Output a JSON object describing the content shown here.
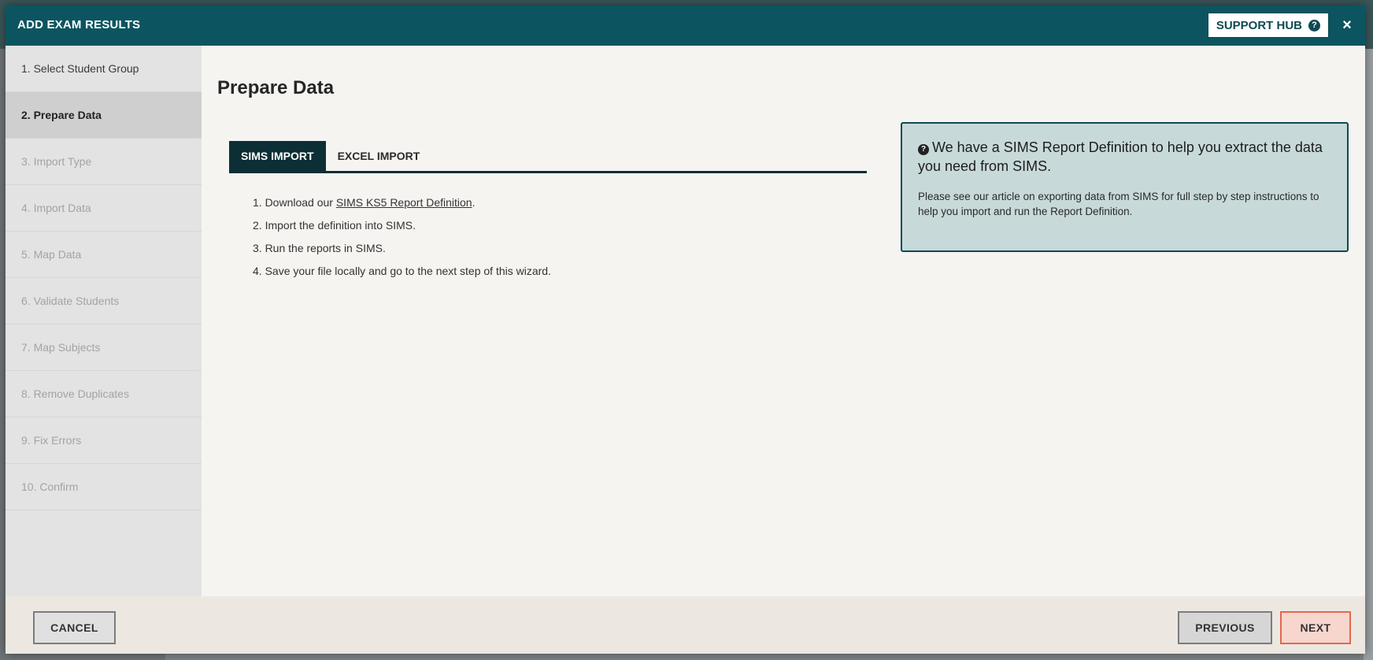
{
  "modal": {
    "title": "ADD EXAM RESULTS",
    "support_hub_label": "SUPPORT HUB",
    "close_glyph": "×"
  },
  "sidebar": {
    "steps": [
      {
        "label": "1. Select Student Group",
        "state": "done"
      },
      {
        "label": "2. Prepare Data",
        "state": "active"
      },
      {
        "label": "3. Import Type",
        "state": "disabled"
      },
      {
        "label": "4. Import Data",
        "state": "disabled"
      },
      {
        "label": "5. Map Data",
        "state": "disabled"
      },
      {
        "label": "6. Validate Students",
        "state": "disabled"
      },
      {
        "label": "7. Map Subjects",
        "state": "disabled"
      },
      {
        "label": "8. Remove Duplicates",
        "state": "disabled"
      },
      {
        "label": "9. Fix Errors",
        "state": "disabled"
      },
      {
        "label": "10. Confirm",
        "state": "disabled"
      }
    ]
  },
  "main": {
    "title": "Prepare Data",
    "tabs": [
      {
        "label": "SIMS IMPORT",
        "active": true
      },
      {
        "label": "EXCEL IMPORT",
        "active": false
      }
    ],
    "instructions": {
      "step1_prefix": "1. Download our ",
      "step1_link": "SIMS KS5 Report Definition",
      "step1_suffix": ".",
      "step2": "2. Import the definition into SIMS.",
      "step3": "3. Run the reports in SIMS.",
      "step4": "4. Save your file locally and go to the next step of this wizard."
    },
    "info_box": {
      "heading": "We have a SIMS Report Definition to help you extract the data you need from SIMS.",
      "body": "Please see our article on exporting data from SIMS for full step by step instructions to help you import and run the Report Definition."
    }
  },
  "footer": {
    "cancel_label": "CANCEL",
    "previous_label": "PREVIOUS",
    "next_label": "NEXT"
  },
  "colors": {
    "header_bg": "#0c5560",
    "tab_active_bg": "#0b2f35",
    "info_bg": "#c8d9da",
    "next_border": "#e2674f",
    "next_bg": "#f7d6cd"
  }
}
